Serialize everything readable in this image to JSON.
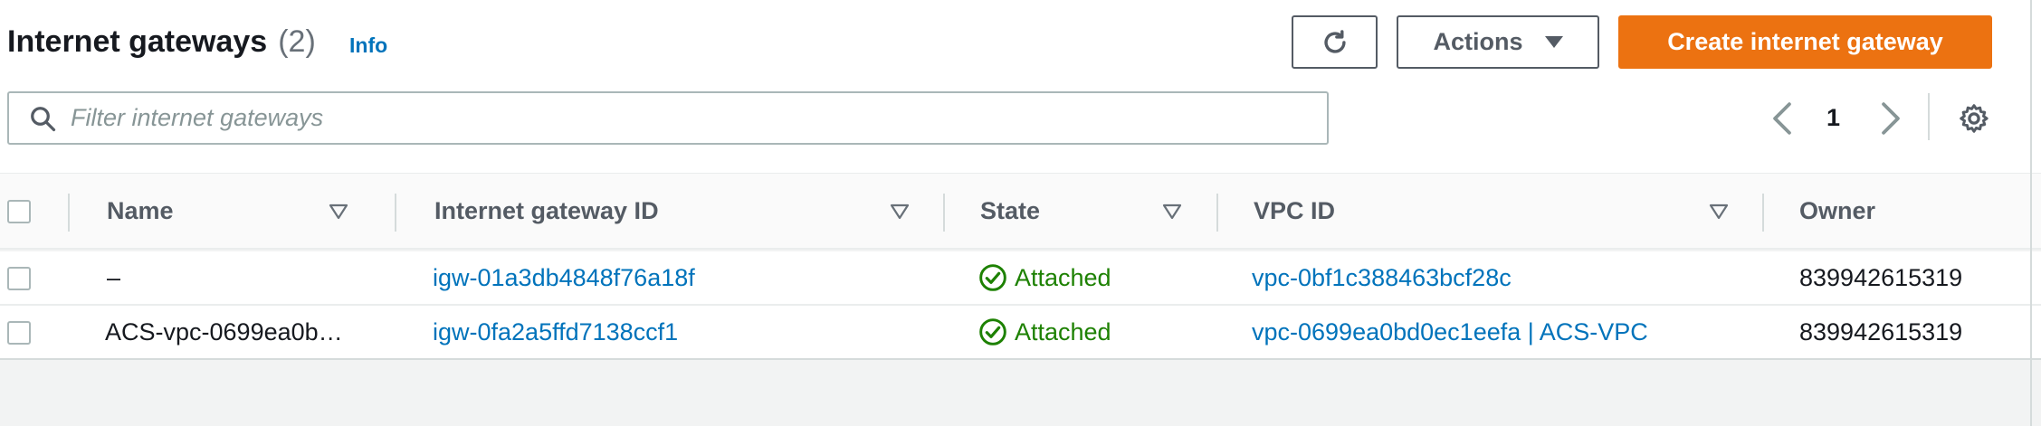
{
  "header": {
    "title": "Internet gateways",
    "count": "(2)",
    "info_label": "Info",
    "actions_label": "Actions",
    "create_label": "Create internet gateway"
  },
  "filter": {
    "placeholder": "Filter internet gateways"
  },
  "pagination": {
    "current_page": "1"
  },
  "table": {
    "columns": [
      "Name",
      "Internet gateway ID",
      "State",
      "VPC ID",
      "Owner"
    ],
    "rows": [
      {
        "name": "–",
        "gateway_id": "igw-01a3db4848f76a18f",
        "state": "Attached",
        "vpc_id": "vpc-0bf1c388463bcf28c",
        "owner": "839942615319"
      },
      {
        "name": "ACS-vpc-0699ea0b…",
        "gateway_id": "igw-0fa2a5ffd7138ccf1",
        "state": "Attached",
        "vpc_id": "vpc-0699ea0bd0ec1eefa | ACS-VPC",
        "owner": "839942615319"
      }
    ]
  },
  "icons": {
    "refresh": "refresh-icon",
    "actions_caret": "caret-down-icon",
    "search": "search-icon",
    "prev": "chevron-left-icon",
    "next": "chevron-right-icon",
    "settings": "gear-icon",
    "sort": "sort-caret-icon",
    "status": "check-circle-icon"
  },
  "colors": {
    "primary_button": "#ec7211",
    "link": "#0073bb",
    "status_success": "#1d8102"
  }
}
